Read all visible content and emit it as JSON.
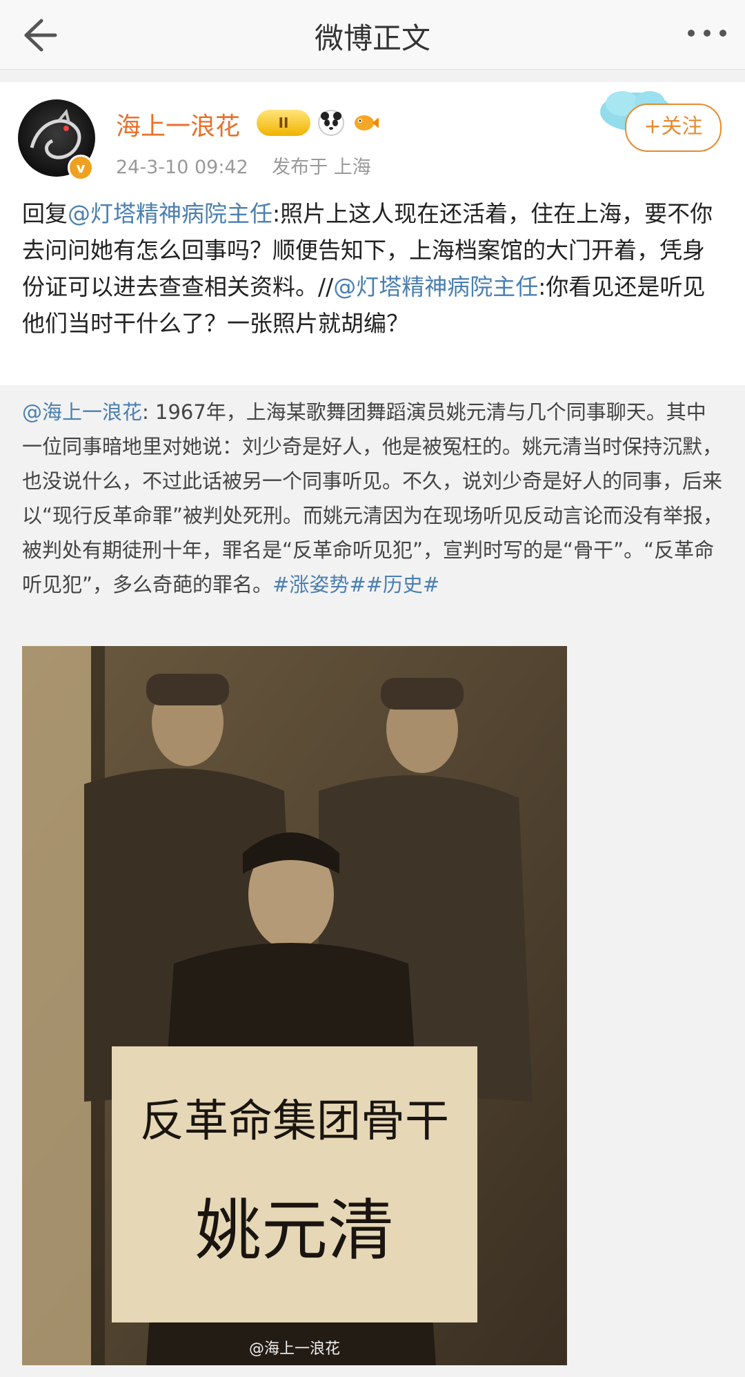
{
  "nav": {
    "title": "微博正文",
    "back_icon": "back-arrow-icon",
    "more_icon": "more-dots-icon"
  },
  "post": {
    "username": "海上一浪花",
    "level_badge": "II",
    "time": "24-3-10 09:42",
    "source": "发布于 上海",
    "follow_label": "+关注",
    "verified_mark": "v",
    "reply_prefix": "回复",
    "mention1": "@灯塔精神病院主任",
    "reply_text1": ":照片上这人现在还活着，住在上海，要不你去问问她有怎么回事吗？顺便告知下，上海档案馆的大门开着，凭身份证可以进去查查相关资料。//",
    "mention2": "@灯塔精神病院主任",
    "reply_text2": ":你看见还是听见他们当时干什么了？一张照片就胡编？"
  },
  "quote": {
    "author": "@海上一浪花",
    "text": ": 1967年，上海某歌舞团舞蹈演员姚元清与几个同事聊天。其中一位同事暗地里对她说：刘少奇是好人，他是被冤枉的。姚元清当时保持沉默，也没说什么，不过此话被另一个同事听见。不久，说刘少奇是好人的同事，后来以“现行反革命罪”被判处死刑。而姚元清因为在现场听见反动言论而没有举报，被判处有期徒刑十年，罪名是“反革命听见犯”，宣判时写的是“骨干”。“反革命听见犯”，多么奇葩的罪名。",
    "hashtags": "#涨姿势##历史#"
  },
  "photo": {
    "placard_line1": "反革命集团骨干",
    "placard_line2": "姚元清",
    "watermark": "@海上一浪花"
  }
}
